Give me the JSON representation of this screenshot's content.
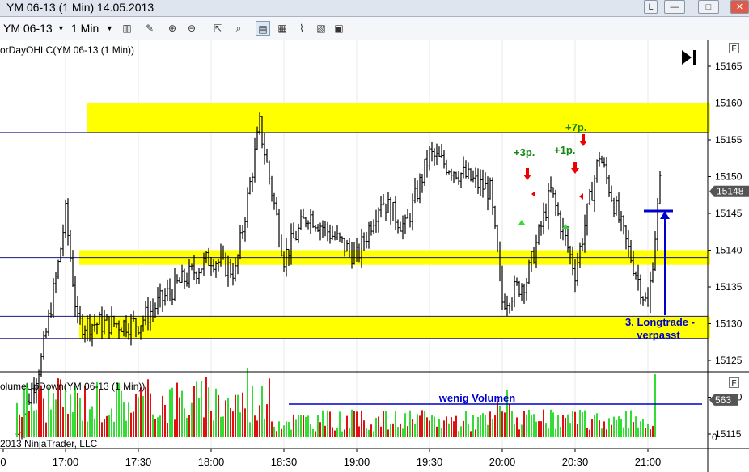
{
  "window": {
    "title": "YM 06-13 (1 Min)  14.05.2013",
    "buttons": {
      "link": "L",
      "minimize": "—",
      "maximize": "□",
      "close": "✕"
    }
  },
  "toolbar": {
    "instrument": "YM 06-13",
    "interval": "1 Min",
    "icons": [
      "candlestick-style-icon",
      "draw-tools-icon",
      "zoom-in-icon",
      "zoom-out-icon",
      "cursor-icon",
      "magnify-icon",
      "data-box-icon",
      "chart-style-icon",
      "trend-icon",
      "properties-icon",
      "order-panel-icon"
    ]
  },
  "price_panel": {
    "indicator_label": "orDayOHLC(YM 06-13 (1 Min))",
    "panel_button": "F",
    "price_axis_labels": [
      "15165",
      "15160",
      "15155",
      "15150",
      "15145",
      "15140",
      "15135",
      "15130",
      "15125",
      "15120",
      "15115"
    ],
    "last_price_label": "15148",
    "annotations": {
      "trade1": "+3p.",
      "trade2": "+1p.",
      "trade3": "+7p.",
      "missed_line1": "3. Longtrade -",
      "missed_line2": "verpasst"
    }
  },
  "volume_panel": {
    "indicator_label": "olumeUpDown(YM 06-13 (1 Min))",
    "panel_button": "F",
    "last_volume_label": "563",
    "axis_zero_label": "0",
    "annotation": "wenig Volumen",
    "copyright": "2013 NinjaTrader, LLC"
  },
  "time_axis_labels": [
    "0",
    "17:00",
    "17:30",
    "18:00",
    "18:30",
    "19:00",
    "19:30",
    "20:00",
    "20:30",
    "21:00"
  ],
  "colors": {
    "zone": "#ffff00",
    "up_bar": "#33dd33",
    "down_bar": "#dd1111",
    "annotation_blue": "#0000cc",
    "annotation_green": "#118811",
    "arrow_red": "#ee0000",
    "price_bars": "#000000"
  },
  "chart_data": [
    {
      "type": "line",
      "description_kind": "OHLC price bars, 1-minute",
      "x_time_range": [
        "16:45",
        "21:05"
      ],
      "ylim": [
        15112,
        15170
      ],
      "zones": [
        {
          "from": 15156,
          "to": 15160
        },
        {
          "from": 15138,
          "to": 15140
        },
        {
          "from": 15128,
          "to": 15131
        }
      ],
      "horizontal_lines": [
        15156,
        15139,
        15131,
        15128
      ],
      "close_series_waypoints": {
        "x": [
          "16:40",
          "16:50",
          "16:57",
          "17:00",
          "17:05",
          "17:10",
          "17:30",
          "17:45",
          "18:00",
          "18:10",
          "18:20",
          "18:30",
          "18:40",
          "19:00",
          "19:10",
          "19:20",
          "19:30",
          "19:45",
          "19:55",
          "20:00",
          "20:10",
          "20:20",
          "20:30",
          "20:40",
          "20:50",
          "21:00",
          "21:05"
        ],
        "y": [
          15115,
          15125,
          15138,
          15145,
          15130,
          15130,
          15130,
          15135,
          15139,
          15137,
          15157,
          15139,
          15145,
          15139,
          15147,
          15143,
          15153,
          15150,
          15148,
          15133,
          15136,
          15148,
          15137,
          15153,
          15142,
          15132,
          15149
        ]
      }
    },
    {
      "type": "bar",
      "description_kind": "volume up/down",
      "ylim": [
        0,
        1200
      ],
      "reference_line": 500
    }
  ]
}
